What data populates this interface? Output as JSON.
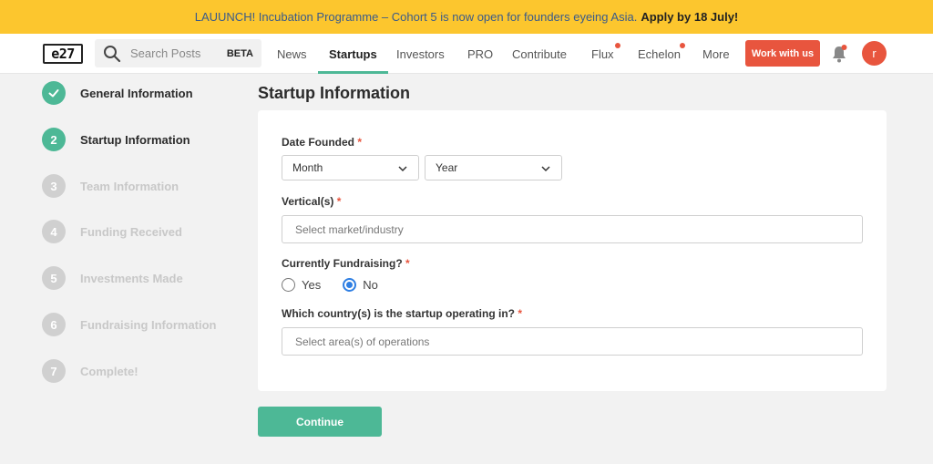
{
  "banner": {
    "text": "LAUUNCH! Incubation Programme – Cohort 5 is now open for founders eyeing Asia.",
    "cta": "Apply by 18 July!"
  },
  "nav": {
    "logo": "e27",
    "search_placeholder": "Search Posts",
    "beta": "BETA",
    "items": [
      "News",
      "Startups",
      "Investors",
      "PRO",
      "Contribute",
      "Flux",
      "Echelon",
      "More"
    ],
    "active": "Startups",
    "work_button": "Work with us",
    "avatar_letter": "r"
  },
  "steps": [
    {
      "num": "",
      "label": "General Information",
      "state": "done"
    },
    {
      "num": "2",
      "label": "Startup Information",
      "state": "current"
    },
    {
      "num": "3",
      "label": "Team Information",
      "state": "pending"
    },
    {
      "num": "4",
      "label": "Funding Received",
      "state": "pending"
    },
    {
      "num": "5",
      "label": "Investments Made",
      "state": "pending"
    },
    {
      "num": "6",
      "label": "Fundraising Information",
      "state": "pending"
    },
    {
      "num": "7",
      "label": "Complete!",
      "state": "pending"
    }
  ],
  "form": {
    "title": "Startup Information",
    "date_founded_label": "Date Founded",
    "month_value": "Month",
    "year_value": "Year",
    "vertical_label": "Vertical(s)",
    "vertical_placeholder": "Select market/industry",
    "fundraising_label": "Currently Fundraising?",
    "yes_label": "Yes",
    "no_label": "No",
    "country_label": "Which country(s) is the startup operating in?",
    "country_placeholder": "Select area(s) of operations",
    "required_mark": "*",
    "continue_label": "Continue"
  },
  "colors": {
    "banner_bg": "#fcc62e",
    "accent": "#4db896",
    "brand_red": "#e8553e",
    "radio_blue": "#2f7fe3"
  }
}
